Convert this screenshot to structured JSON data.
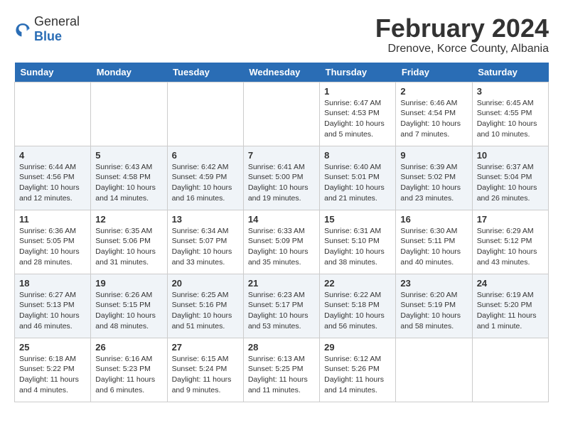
{
  "header": {
    "logo": {
      "general": "General",
      "blue": "Blue"
    },
    "title": "February 2024",
    "location": "Drenove, Korce County, Albania"
  },
  "days_of_week": [
    "Sunday",
    "Monday",
    "Tuesday",
    "Wednesday",
    "Thursday",
    "Friday",
    "Saturday"
  ],
  "weeks": [
    [
      {
        "day": "",
        "info": ""
      },
      {
        "day": "",
        "info": ""
      },
      {
        "day": "",
        "info": ""
      },
      {
        "day": "",
        "info": ""
      },
      {
        "day": "1",
        "info": "Sunrise: 6:47 AM\nSunset: 4:53 PM\nDaylight: 10 hours\nand 5 minutes."
      },
      {
        "day": "2",
        "info": "Sunrise: 6:46 AM\nSunset: 4:54 PM\nDaylight: 10 hours\nand 7 minutes."
      },
      {
        "day": "3",
        "info": "Sunrise: 6:45 AM\nSunset: 4:55 PM\nDaylight: 10 hours\nand 10 minutes."
      }
    ],
    [
      {
        "day": "4",
        "info": "Sunrise: 6:44 AM\nSunset: 4:56 PM\nDaylight: 10 hours\nand 12 minutes."
      },
      {
        "day": "5",
        "info": "Sunrise: 6:43 AM\nSunset: 4:58 PM\nDaylight: 10 hours\nand 14 minutes."
      },
      {
        "day": "6",
        "info": "Sunrise: 6:42 AM\nSunset: 4:59 PM\nDaylight: 10 hours\nand 16 minutes."
      },
      {
        "day": "7",
        "info": "Sunrise: 6:41 AM\nSunset: 5:00 PM\nDaylight: 10 hours\nand 19 minutes."
      },
      {
        "day": "8",
        "info": "Sunrise: 6:40 AM\nSunset: 5:01 PM\nDaylight: 10 hours\nand 21 minutes."
      },
      {
        "day": "9",
        "info": "Sunrise: 6:39 AM\nSunset: 5:02 PM\nDaylight: 10 hours\nand 23 minutes."
      },
      {
        "day": "10",
        "info": "Sunrise: 6:37 AM\nSunset: 5:04 PM\nDaylight: 10 hours\nand 26 minutes."
      }
    ],
    [
      {
        "day": "11",
        "info": "Sunrise: 6:36 AM\nSunset: 5:05 PM\nDaylight: 10 hours\nand 28 minutes."
      },
      {
        "day": "12",
        "info": "Sunrise: 6:35 AM\nSunset: 5:06 PM\nDaylight: 10 hours\nand 31 minutes."
      },
      {
        "day": "13",
        "info": "Sunrise: 6:34 AM\nSunset: 5:07 PM\nDaylight: 10 hours\nand 33 minutes."
      },
      {
        "day": "14",
        "info": "Sunrise: 6:33 AM\nSunset: 5:09 PM\nDaylight: 10 hours\nand 35 minutes."
      },
      {
        "day": "15",
        "info": "Sunrise: 6:31 AM\nSunset: 5:10 PM\nDaylight: 10 hours\nand 38 minutes."
      },
      {
        "day": "16",
        "info": "Sunrise: 6:30 AM\nSunset: 5:11 PM\nDaylight: 10 hours\nand 40 minutes."
      },
      {
        "day": "17",
        "info": "Sunrise: 6:29 AM\nSunset: 5:12 PM\nDaylight: 10 hours\nand 43 minutes."
      }
    ],
    [
      {
        "day": "18",
        "info": "Sunrise: 6:27 AM\nSunset: 5:13 PM\nDaylight: 10 hours\nand 46 minutes."
      },
      {
        "day": "19",
        "info": "Sunrise: 6:26 AM\nSunset: 5:15 PM\nDaylight: 10 hours\nand 48 minutes."
      },
      {
        "day": "20",
        "info": "Sunrise: 6:25 AM\nSunset: 5:16 PM\nDaylight: 10 hours\nand 51 minutes."
      },
      {
        "day": "21",
        "info": "Sunrise: 6:23 AM\nSunset: 5:17 PM\nDaylight: 10 hours\nand 53 minutes."
      },
      {
        "day": "22",
        "info": "Sunrise: 6:22 AM\nSunset: 5:18 PM\nDaylight: 10 hours\nand 56 minutes."
      },
      {
        "day": "23",
        "info": "Sunrise: 6:20 AM\nSunset: 5:19 PM\nDaylight: 10 hours\nand 58 minutes."
      },
      {
        "day": "24",
        "info": "Sunrise: 6:19 AM\nSunset: 5:20 PM\nDaylight: 11 hours\nand 1 minute."
      }
    ],
    [
      {
        "day": "25",
        "info": "Sunrise: 6:18 AM\nSunset: 5:22 PM\nDaylight: 11 hours\nand 4 minutes."
      },
      {
        "day": "26",
        "info": "Sunrise: 6:16 AM\nSunset: 5:23 PM\nDaylight: 11 hours\nand 6 minutes."
      },
      {
        "day": "27",
        "info": "Sunrise: 6:15 AM\nSunset: 5:24 PM\nDaylight: 11 hours\nand 9 minutes."
      },
      {
        "day": "28",
        "info": "Sunrise: 6:13 AM\nSunset: 5:25 PM\nDaylight: 11 hours\nand 11 minutes."
      },
      {
        "day": "29",
        "info": "Sunrise: 6:12 AM\nSunset: 5:26 PM\nDaylight: 11 hours\nand 14 minutes."
      },
      {
        "day": "",
        "info": ""
      },
      {
        "day": "",
        "info": ""
      }
    ]
  ]
}
